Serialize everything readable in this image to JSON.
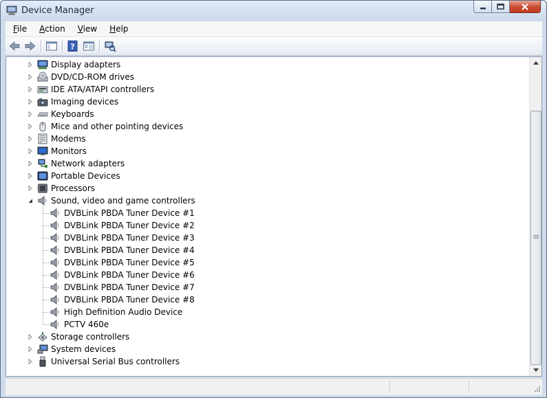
{
  "window": {
    "title": "Device Manager"
  },
  "menu": [
    {
      "label": "File",
      "accel": "F",
      "rest": "ile"
    },
    {
      "label": "Action",
      "accel": "A",
      "rest": "ction"
    },
    {
      "label": "View",
      "accel": "V",
      "rest": "iew"
    },
    {
      "label": "Help",
      "accel": "H",
      "rest": "elp"
    }
  ],
  "toolbar": {
    "buttons": [
      "back-arrow-icon",
      "forward-arrow-icon",
      "show-hide-console-tree-icon",
      "help-icon",
      "properties-icon",
      "scan-hardware-changes-icon"
    ]
  },
  "tree": {
    "categories": [
      {
        "label": "Display adapters",
        "icon": "display-adapter-icon",
        "expanded": false
      },
      {
        "label": "DVD/CD-ROM drives",
        "icon": "dvd-drive-icon",
        "expanded": false
      },
      {
        "label": "IDE ATA/ATAPI controllers",
        "icon": "ide-controller-icon",
        "expanded": false
      },
      {
        "label": "Imaging devices",
        "icon": "camera-icon",
        "expanded": false
      },
      {
        "label": "Keyboards",
        "icon": "keyboard-icon",
        "expanded": false
      },
      {
        "label": "Mice and other pointing devices",
        "icon": "mouse-icon",
        "expanded": false
      },
      {
        "label": "Modems",
        "icon": "modem-icon",
        "expanded": false
      },
      {
        "label": "Monitors",
        "icon": "monitor-icon",
        "expanded": false
      },
      {
        "label": "Network adapters",
        "icon": "network-adapter-icon",
        "expanded": false
      },
      {
        "label": "Portable Devices",
        "icon": "portable-device-icon",
        "expanded": false
      },
      {
        "label": "Processors",
        "icon": "processor-icon",
        "expanded": false
      },
      {
        "label": "Sound, video and game controllers",
        "icon": "speaker-icon",
        "expanded": true,
        "children": [
          "DVBLink PBDA Tuner Device #1",
          "DVBLink PBDA Tuner Device #2",
          "DVBLink PBDA Tuner Device #3",
          "DVBLink PBDA Tuner Device #4",
          "DVBLink PBDA Tuner Device #5",
          "DVBLink PBDA Tuner Device #6",
          "DVBLink PBDA Tuner Device #7",
          "DVBLink PBDA Tuner Device #8",
          "High Definition Audio Device",
          "PCTV 460e"
        ]
      },
      {
        "label": "Storage controllers",
        "icon": "storage-controller-icon",
        "expanded": false
      },
      {
        "label": "System devices",
        "icon": "system-device-icon",
        "expanded": false
      },
      {
        "label": "Universal Serial Bus controllers",
        "icon": "usb-icon",
        "expanded": false
      }
    ]
  },
  "colors": {
    "titlebar": "#cfdcec",
    "close_button": "#c84a2f",
    "tree_line": "#9aa4b0"
  }
}
